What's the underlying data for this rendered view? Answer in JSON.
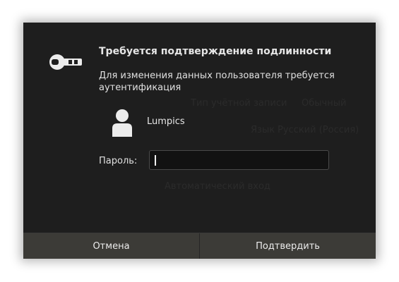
{
  "dialog": {
    "title": "Требуется подтверждение подлинности",
    "message": "Для изменения данных пользователя требуется аутентификация",
    "user": {
      "name": "Lumpics",
      "icon": "user-icon"
    },
    "password": {
      "label": "Пароль:",
      "value": ""
    },
    "icon": "key-icon",
    "buttons": {
      "cancel": "Отмена",
      "confirm": "Подтвердить"
    }
  },
  "background_ghost_text": [
    "Тип учётной записи",
    "Обычный",
    "Язык",
    "Русский (Россия)",
    "Автоматический вход"
  ],
  "colors": {
    "dialog_bg": "#1e1e1e",
    "button_bg": "#3c3b37",
    "text": "#e6e6e6"
  }
}
